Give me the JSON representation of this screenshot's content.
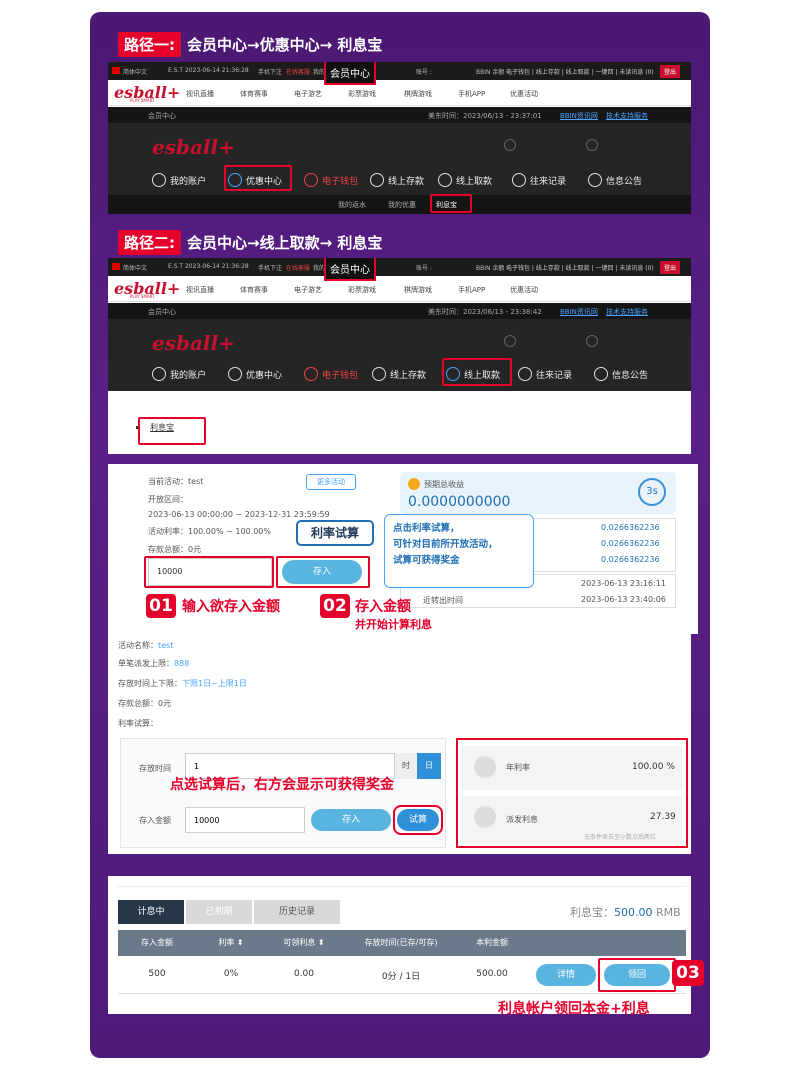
{
  "path1": {
    "tag": "路径一:",
    "route": "会员中心→优惠中心→ 利息宝"
  },
  "path2": {
    "tag": "路径二:",
    "route": "会员中心→线上取款→ 利息宝"
  },
  "topbar": {
    "lang": "简体中文",
    "time": "E.S.T 2023-06-14 21:36:28",
    "phone": "手机下注",
    "service": "在线客服",
    "msg": "我的讯",
    "member_center": "会员中心",
    "account": "账号 :",
    "balance": "BBIN 余额 :",
    "links": "电子钱包 | 线上存款 | 线上取款 | 一键回 | 未读讯息 (0)",
    "logout": "登出"
  },
  "nav": {
    "logo": "esball+",
    "slogan": "PLAY SMART",
    "items": [
      "视讯直播",
      "体育赛事",
      "电子游艺",
      "彩票游戏",
      "棋牌游戏",
      "手机APP",
      "优惠活动"
    ]
  },
  "sub1": {
    "left": "会员中心",
    "time": "美东时间：2023/06/13 - 23:37:01",
    "bbin": "BBIN资讯网",
    "support": "技术支持服务"
  },
  "sub2": {
    "left": "会员中心",
    "time": "美东时间：2023/06/13 - 23:38:42",
    "bbin": "BBIN资讯网",
    "support": "技术支持服务"
  },
  "menu": {
    "account": "我的账户",
    "promo": "优惠中心",
    "wallet": "电子钱包",
    "deposit": "线上存款",
    "withdraw": "线上取款",
    "records": "往来记录",
    "news": "信息公告"
  },
  "tabs1": {
    "a": "我的返水",
    "b": "我的优惠",
    "c": "利息宝"
  },
  "link2": "利息宝",
  "panel3": {
    "activity": "当前活动：test",
    "more": "更多活动",
    "period_label": "开放区间：",
    "period": "2023-06-13 00:00:00 ~ 2023-12-31 23:59:59",
    "rate": "活动利率：100.00% ~ 100.00%",
    "total": "存款总额：0元",
    "amount": "10000",
    "deposit_btn": "存入",
    "expect_label": "预期总收益",
    "expect_value": "0.0000000000",
    "timer": "3s",
    "v1": "0.0266362236",
    "v2": "0.0266362236",
    "v3": "0.0266362236",
    "d1": "2023-06-13 23:16:11",
    "last_label": "近转出时间",
    "d2": "2023-06-13 23:40:06",
    "calc_tag": "利率试算",
    "tip": [
      "点击利率试算，",
      "可针对目前所开放活动，",
      "试算可获得奖金"
    ],
    "n1": "01",
    "s1": "输入欲存入金额",
    "n2": "02",
    "s2": "存入金额",
    "s2b": "并开始计算利息"
  },
  "panel4": {
    "name_label": "活动名称：",
    "name": "test",
    "single_label": "单笔派发上限：",
    "single": "888",
    "time_label": "存放时间上下限：",
    "time": "下限1日~上限1日",
    "total": "存款总额：0元",
    "calc": "利率试算：",
    "store_label": "存放时间",
    "store_value": "1",
    "unit_hour": "时",
    "unit_day": "日",
    "amount_label": "存入金额",
    "amount_value": "10000",
    "deposit_btn": "存入",
    "calc_btn": "试算",
    "hint": "点选试算后，右方会显示可获得奖金",
    "rate_label": "年利率",
    "rate_value": "100.00 %",
    "int_label": "派发利息",
    "int_value": "27.39",
    "note": "无条件舍去至小数点后两位"
  },
  "panel5": {
    "tabs": [
      "计息中",
      "已到期",
      "历史记录"
    ],
    "balance_label": "利息宝：",
    "balance_value": "500.00",
    "balance_unit": "RMB",
    "headers": [
      "存入金额",
      "利率 ⬍",
      "可领利息 ⬍",
      "存放时间(已存/可存)",
      "本利金额",
      ""
    ],
    "row": [
      "500",
      "0%",
      "0.00",
      "0分 / 1日",
      "500.00"
    ],
    "detail_btn": "详情",
    "claim_btn": "领回",
    "n3": "03",
    "note": "利息帐户领回本金+利息"
  }
}
